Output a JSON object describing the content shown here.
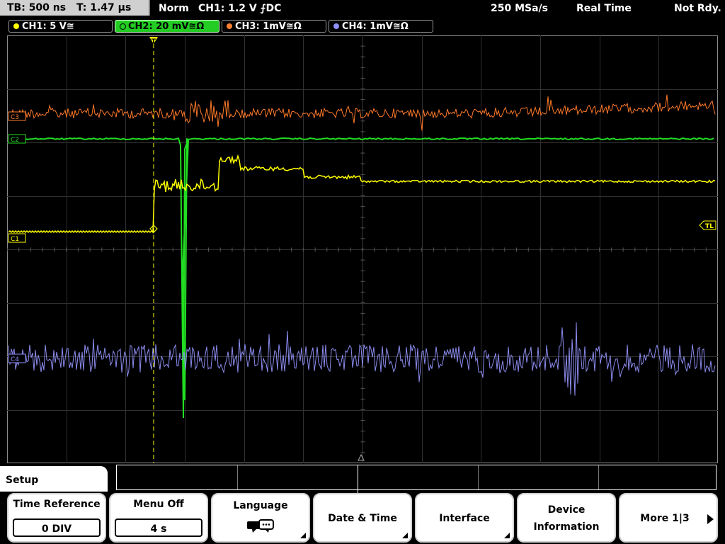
{
  "top": {
    "timebase": "TB: 500 ns",
    "trigger_time": "T: 1.47 µs",
    "mode": "Norm",
    "trigger_info": "CH1: 1.2 V ⨍DC",
    "sample_rate": "250 MSa/s",
    "acq_mode": "Real Time",
    "status": "Not Rdy."
  },
  "channels": [
    {
      "label": "CH1: 5 V≅",
      "color": "#ffff00"
    },
    {
      "label": "CH2: 20 mV≅Ω",
      "color": "#22dd22"
    },
    {
      "label": "CH3: 1mV≅Ω",
      "color": "#ff8030"
    },
    {
      "label": "CH4: 1mV≅Ω",
      "color": "#9090ff"
    }
  ],
  "markers": {
    "c1": "C1",
    "c2": "C2",
    "c3": "C3",
    "c4": "C4",
    "trigger_level": "TL",
    "trigger_pos": "T"
  },
  "menu": {
    "title": "Setup",
    "softkeys": [
      {
        "title": "Time Reference",
        "value": "0 DIV"
      },
      {
        "title": "Menu Off",
        "value": "4 s"
      },
      {
        "title": "Language",
        "icon": "speech-bubbles-icon"
      },
      {
        "title": "Date & Time"
      },
      {
        "title": "Interface"
      },
      {
        "title": "Device",
        "title2": "Information"
      },
      {
        "title": "More 1|3"
      }
    ]
  }
}
